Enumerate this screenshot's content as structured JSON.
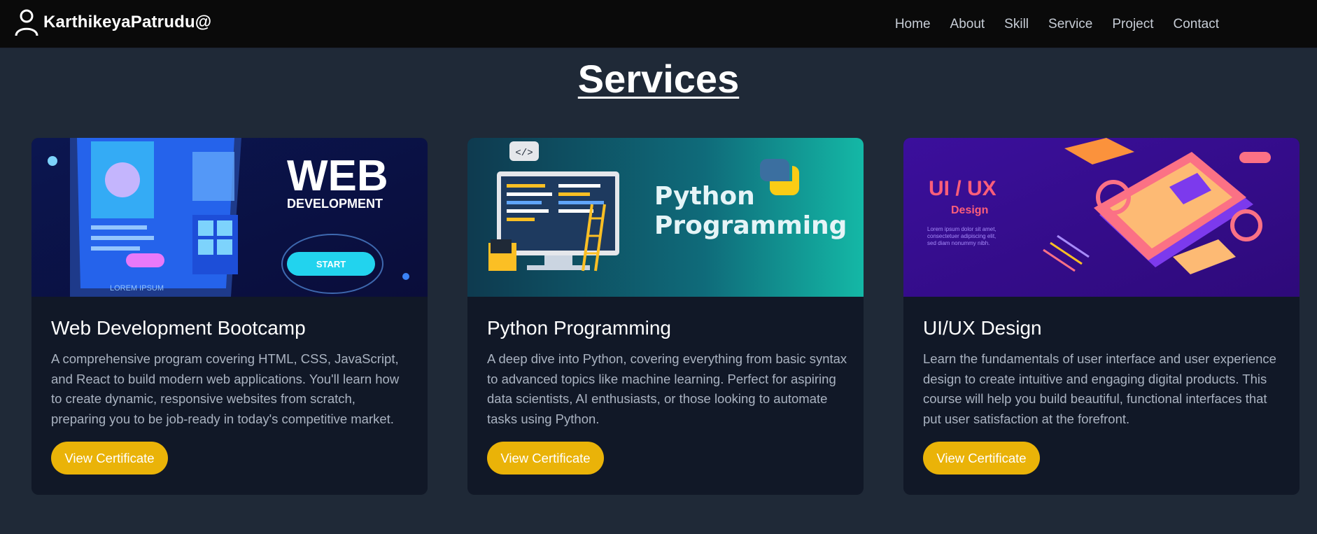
{
  "nav": {
    "brand": "KarthikeyaPatrudu@",
    "brand_icon": "user-icon",
    "links": [
      "Home",
      "About",
      "Skill",
      "Service",
      "Project",
      "Contact"
    ]
  },
  "page_title": "Services",
  "cards": [
    {
      "image_icon": "web-development-illustration",
      "image_text": {
        "big": "WEB",
        "sub": "DEVELOPMENT",
        "button": "START",
        "caption": "LOREM IPSUM"
      },
      "title": "Web Development Bootcamp",
      "description": "A comprehensive program covering HTML, CSS, JavaScript, and React to build modern web applications. You'll learn how to create dynamic, responsive websites from scratch, preparing you to be job-ready in today's competitive market.",
      "button": "View Certificate"
    },
    {
      "image_icon": "python-programming-illustration",
      "image_text": {
        "line1": "Python",
        "line2": "Programming",
        "code": "</>"
      },
      "title": "Python Programming",
      "description": "A deep dive into Python, covering everything from basic syntax to advanced topics like machine learning. Perfect for aspiring data scientists, AI enthusiasts, or those looking to automate tasks using Python.",
      "button": "View Certificate"
    },
    {
      "image_icon": "uiux-design-illustration",
      "image_text": {
        "big": "UI / UX",
        "sub": "Design",
        "lorem": [
          "Lorem ipsum dolor sit amet,",
          "consectetuer adipiscing elit,",
          "sed diam nonummy nibh."
        ]
      },
      "title": "UI/UX Design",
      "description": "Learn the fundamentals of user interface and user experience design to create intuitive and engaging digital products. This course will help you build beautiful, functional interfaces that put user satisfaction at the forefront.",
      "button": "View Certificate"
    }
  ],
  "colors": {
    "background": "#1f2937",
    "navbar": "#0a0a0a",
    "card": "#111827",
    "accent": "#eab308",
    "body_text": "#aab3c1"
  }
}
